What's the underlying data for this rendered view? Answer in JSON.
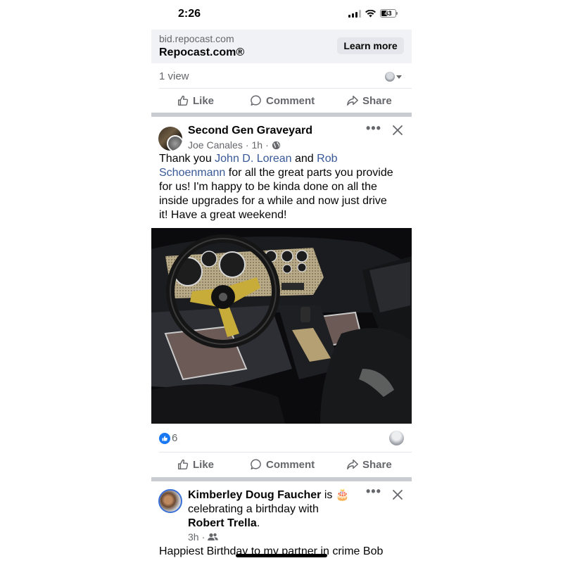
{
  "status_bar": {
    "time": "2:26",
    "battery": "43"
  },
  "ad": {
    "domain": "bid.repocast.com",
    "title": "Repocast.com®",
    "cta": "Learn more"
  },
  "views": {
    "text": "1 view"
  },
  "actions": {
    "like": "Like",
    "comment": "Comment",
    "share": "Share"
  },
  "post": {
    "group": "Second Gen Graveyard",
    "author": "Joe Canales",
    "time": "1h",
    "body": {
      "p1": "Thank you ",
      "mention1": "John D. Lorean",
      "p2": " and ",
      "mention2_line1": "Rob",
      "mention2_line2": "Schoenmann",
      "p3": " for all the great parts you provide",
      "line3": "for us!  I'm happy to be kinda done on all the",
      "line4": "inside upgrades for a while and now just drive",
      "line5": "it!  Have a great weekend!"
    },
    "reaction_count": "6"
  },
  "post2": {
    "name": "Kimberley Doug Faucher",
    "is_text": " is ",
    "celebrating": "celebrating a birthday with",
    "with_name": "Robert Trella",
    "period": ".",
    "time": "3h",
    "body_start": "Happiest Birthday to my partner in crime Bob"
  },
  "colors": {
    "link": "#385898",
    "accent": "#1877f2",
    "muted": "#65676b"
  }
}
